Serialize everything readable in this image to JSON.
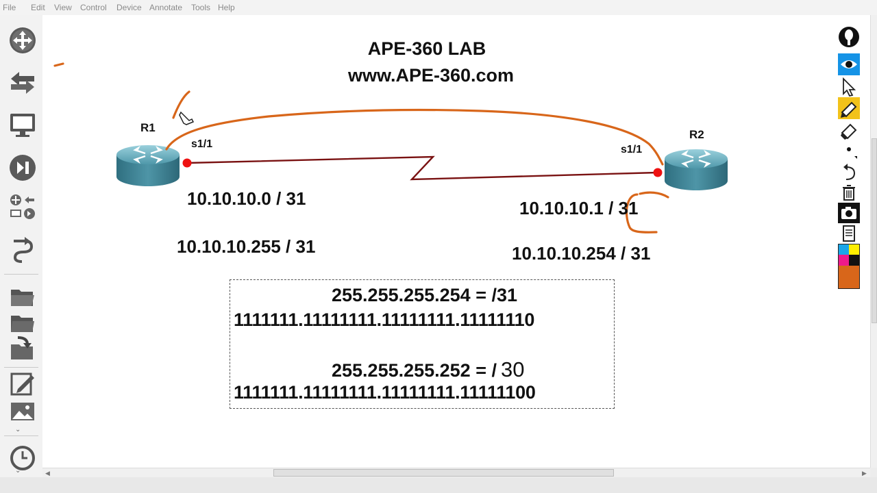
{
  "menu": [
    "File",
    "Edit",
    "View",
    "Control",
    "Device",
    "Annotate",
    "Tools",
    "Help"
  ],
  "toolbar": {
    "tools": [
      "move-arrows-icon",
      "swap-arrows-icon",
      "monitor-icon",
      "play-pause-icon",
      "device-group-icon",
      "curved-arrow-icon",
      "open-folder-icon",
      "folder-icon",
      "save-folder-icon",
      "edit-note-icon",
      "picture-icon",
      "clock-icon"
    ]
  },
  "diagram": {
    "title": "APE-360 LAB",
    "subtitle": "www.APE-360.com",
    "routers": [
      {
        "name": "R1",
        "interface": "s1/1"
      },
      {
        "name": "R2",
        "interface": "s1/1"
      }
    ],
    "ips": {
      "r1_net": "10.10.10.0 / 31",
      "r1_bcast": "10.10.10.255 / 31",
      "r2_net": "10.10.10.1 / 31",
      "r2_bcast": "10.10.10.254 / 31"
    },
    "masks": {
      "m1": "255.255.255.254 = /31",
      "b1": "1111111.11111111.11111111.11111110",
      "m2_prefix": "255.255.255.252 = /",
      "m2_value": "30",
      "b2": "1111111.11111111.11111111.11111100"
    }
  },
  "colors": {
    "annotation": "#d8661a",
    "link": "#7a1212",
    "endpoint": "#ee1111"
  },
  "palette": {
    "tools": [
      "pen-mode-icon",
      "eye-icon",
      "cursor-icon",
      "highlighter-icon",
      "eraser-icon",
      "dot-size-icon",
      "undo-icon",
      "trash-icon",
      "camera-icon",
      "document-icon",
      "color-swatch-icon"
    ]
  }
}
